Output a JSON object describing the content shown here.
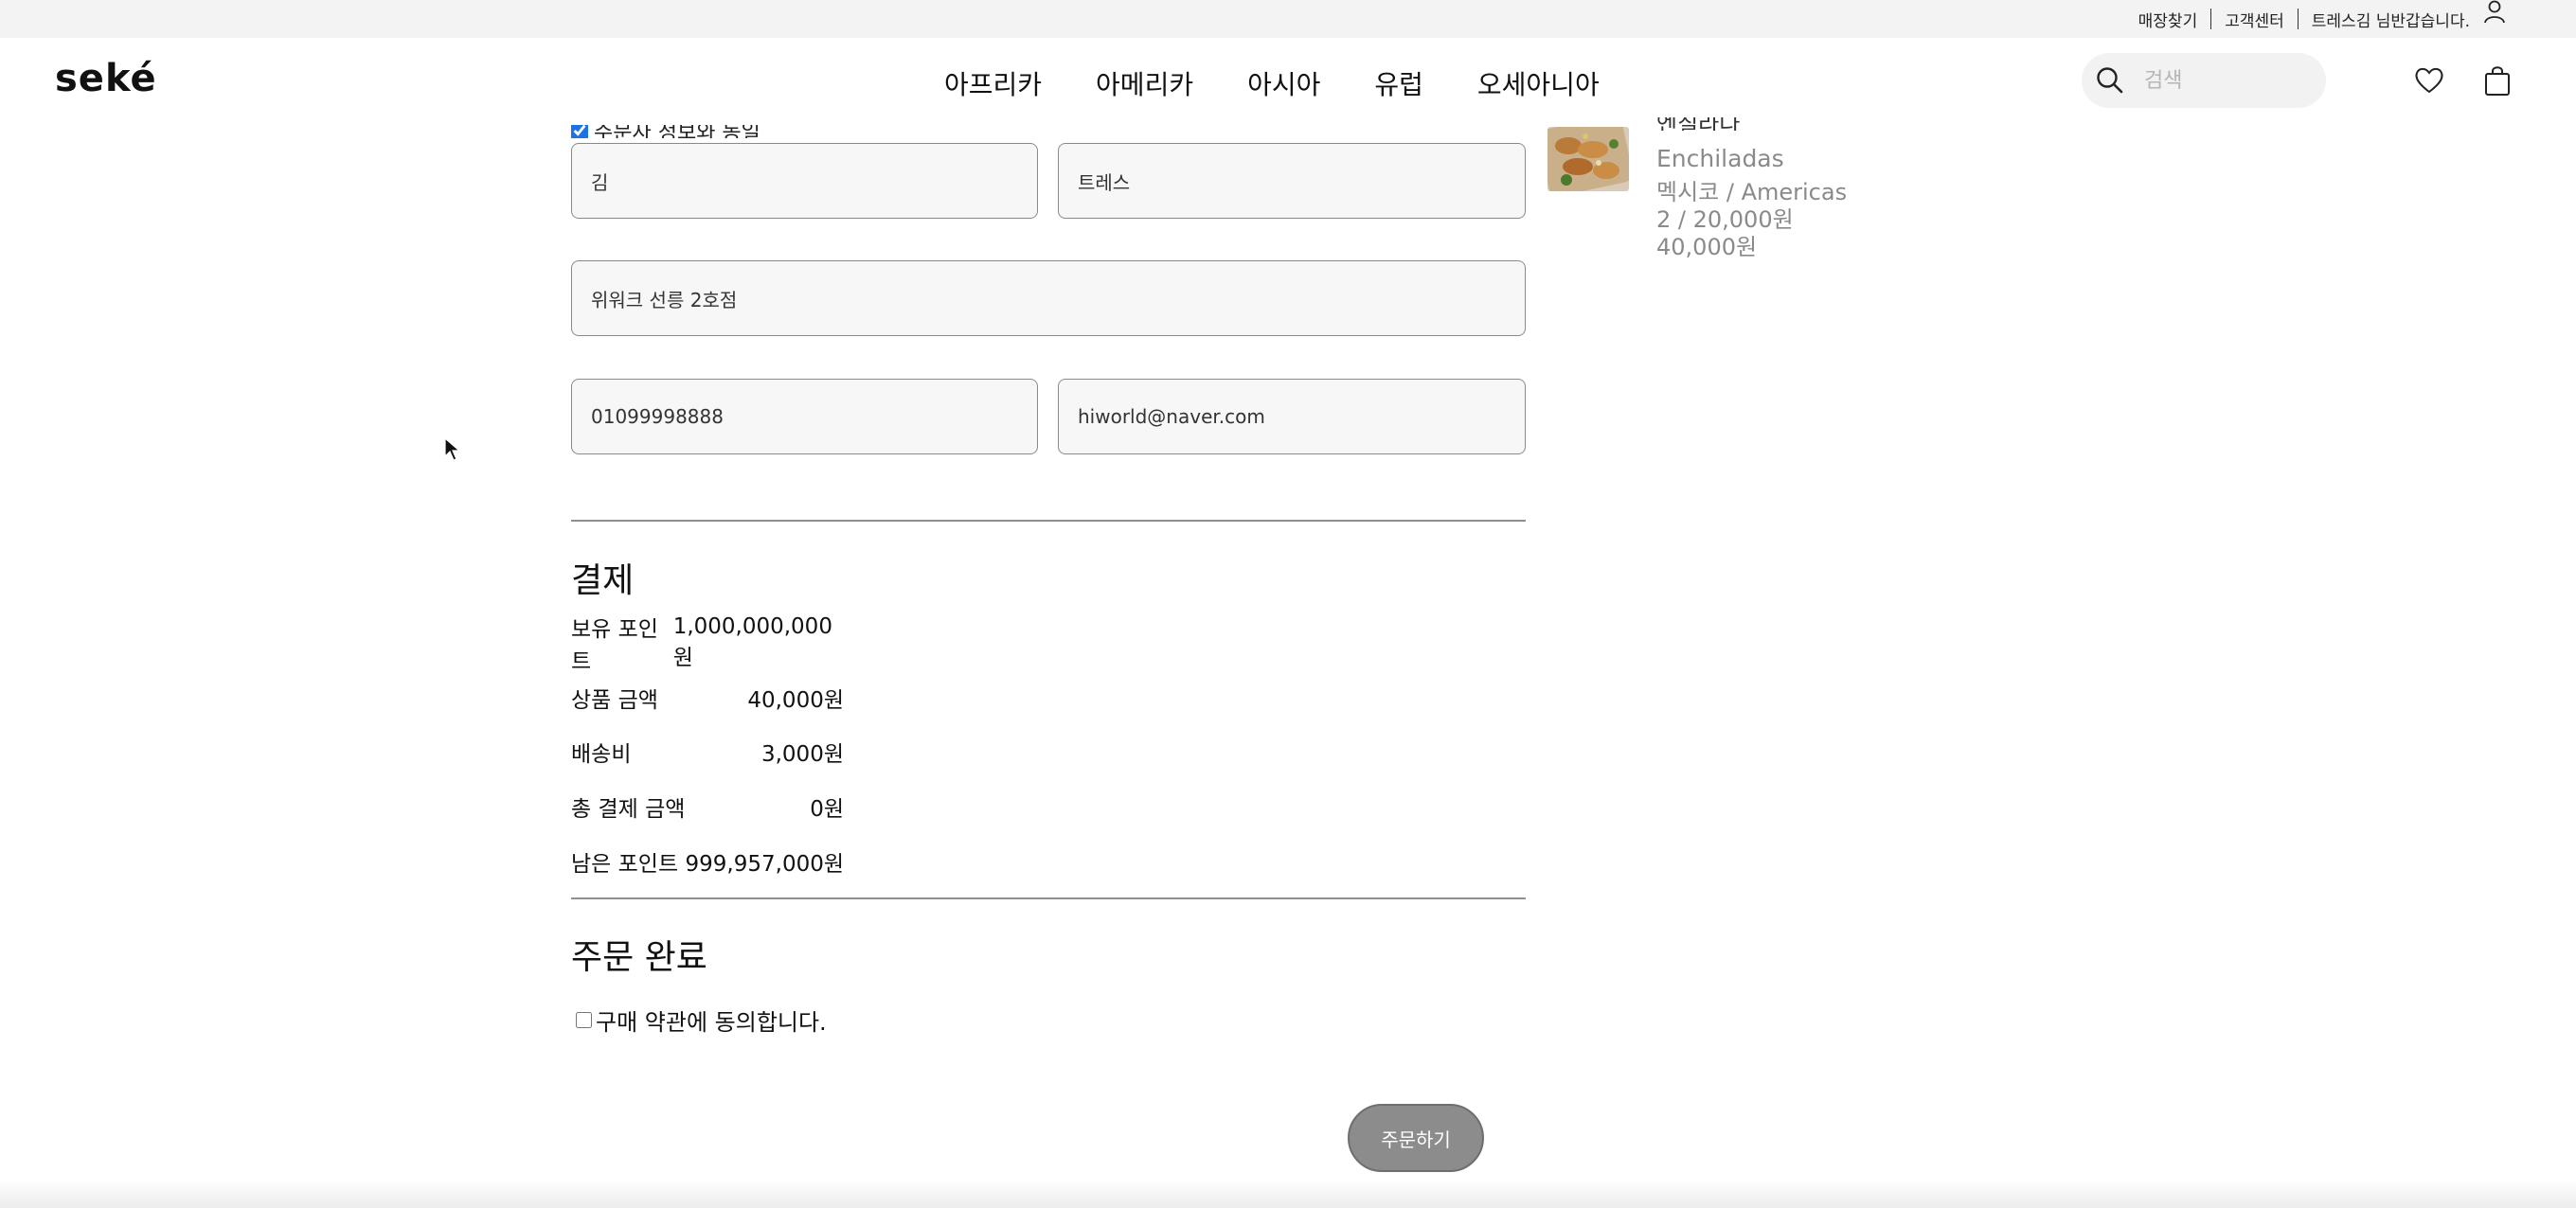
{
  "utility": {
    "store_finder": "매장찾기",
    "customer_center": "고객센터",
    "greeting": "트레스김 님반갑습니다."
  },
  "header": {
    "logo": "seké",
    "nav": [
      "아프리카",
      "아메리카",
      "아시아",
      "유럽",
      "오세아니아"
    ],
    "search_placeholder": "검색"
  },
  "orderer": {
    "same_info_label": "주문자 정보와 동일",
    "last_name": "김",
    "first_name": "트레스",
    "address": "위워크 선릉 2호점",
    "phone": "01099998888",
    "email": "hiworld@naver.com"
  },
  "payment": {
    "title": "결제",
    "rows": [
      {
        "label": "보유 포인트",
        "value": "1,000,000,000원"
      },
      {
        "label": "상품 금액",
        "value": "40,000원"
      },
      {
        "label": "배송비",
        "value": "3,000원"
      },
      {
        "label": "총 결제 금액",
        "value": "0원"
      },
      {
        "label": "남은 포인트",
        "value": "999,957,000원"
      }
    ]
  },
  "complete": {
    "title": "주문 완료",
    "agree_label": "구매 약관에 동의합니다.",
    "order_button": "주문하기"
  },
  "product": {
    "name_kor": "엔칠라다",
    "name_eng": "Enchiladas",
    "origin": "멕시코 / Americas",
    "qty_price": "2 / 20,000원",
    "total": "40,000원"
  },
  "colors": {
    "utility_bg": "#f3f3f3",
    "field_bg": "#f7f7f7",
    "button_bg": "#8c8c8c",
    "muted_text": "#8a8a8a"
  }
}
